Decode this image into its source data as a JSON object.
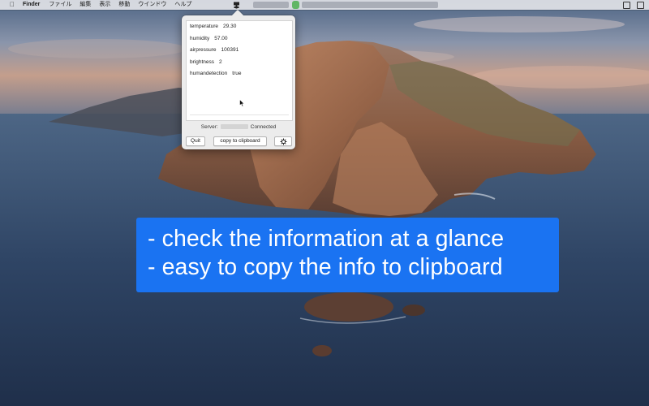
{
  "menubar": {
    "app_name": "Finder",
    "menus": [
      "ファイル",
      "編集",
      "表示",
      "移動",
      "ウインドウ",
      "ヘルプ"
    ],
    "apple_icon": "apple-logo-icon",
    "status_icon": "sensor-app-icon"
  },
  "readings": [
    {
      "label": "temperature",
      "value": "29.30"
    },
    {
      "label": "humidity",
      "value": "57.00"
    },
    {
      "label": "airpressure",
      "value": "100391"
    },
    {
      "label": "brightness",
      "value": "2"
    },
    {
      "label": "humandetection",
      "value": "true"
    }
  ],
  "server": {
    "label": "Server:",
    "status": "Connected"
  },
  "buttons": {
    "quit": "Quit",
    "copy": "copy to clipboard",
    "settings_icon": "gear-icon"
  },
  "caption": {
    "line1": "- check the information at a glance",
    "line2": "- easy to copy the info to clipboard"
  },
  "colors": {
    "caption_bg": "#1a73f2",
    "popover_bg": "#ececec",
    "status_green": "#4caf50"
  }
}
